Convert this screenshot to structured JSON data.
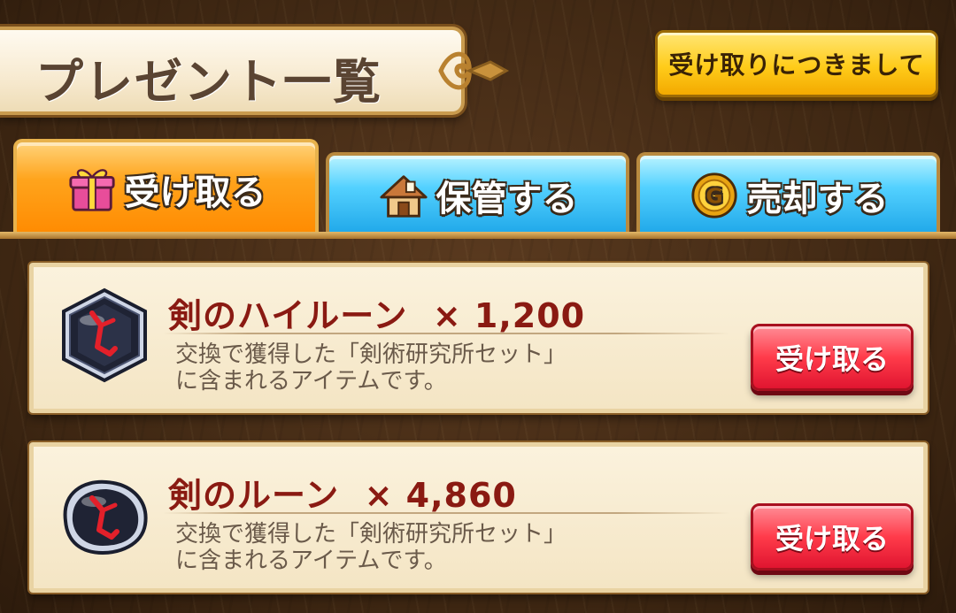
{
  "header": {
    "title": "プレゼント一覧",
    "info_button": "受け取りにつきまして"
  },
  "tabs": [
    {
      "label": "受け取る",
      "icon": "gift-box-icon",
      "active": true
    },
    {
      "label": "保管する",
      "icon": "house-icon",
      "active": false
    },
    {
      "label": "売却する",
      "icon": "gold-coin-icon",
      "active": false
    }
  ],
  "items": [
    {
      "name": "剣のハイルーン",
      "quantity": "× 1,200",
      "icon": "high-rune-icon",
      "description": "交換で獲得した「剣術研究所セット」\nに含まれるアイテムです。",
      "button": "受け取る"
    },
    {
      "name": "剣のルーン",
      "quantity": "× 4,860",
      "icon": "rune-icon",
      "description": "交換で獲得した「剣術研究所セット」\nに含まれるアイテムです。",
      "button": "受け取る"
    }
  ],
  "colors": {
    "active_tab": "#ff9a10",
    "inactive_tab": "#3cc2f5",
    "receive_button": "#ff3b4a",
    "info_button": "#ffcc1a",
    "item_name": "#8a1a12"
  }
}
